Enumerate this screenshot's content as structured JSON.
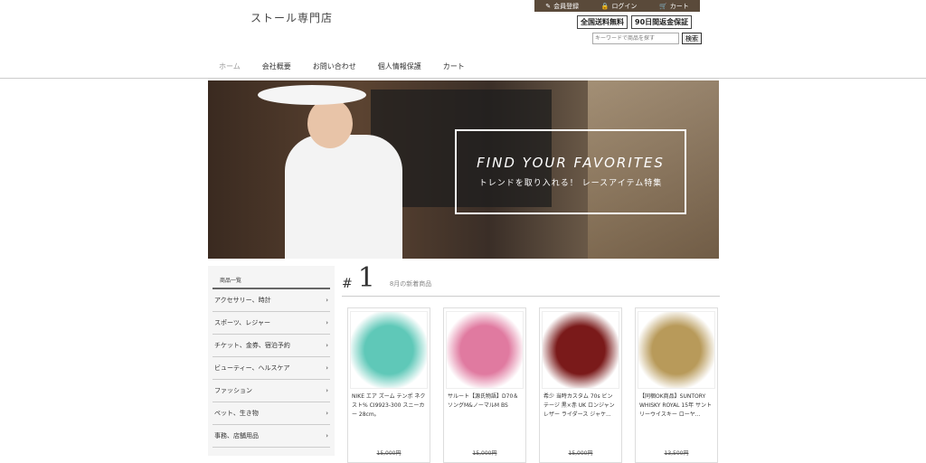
{
  "site": {
    "logo": "ストール専門店"
  },
  "topbar": {
    "register": "会員登録",
    "login": "ログイン",
    "cart": "カート"
  },
  "badges": [
    "全国送料無料",
    "90日間返金保証"
  ],
  "search": {
    "placeholder": "キーワードで商品を探す",
    "button": "検索"
  },
  "nav": [
    "ホーム",
    "会社概要",
    "お問い合わせ",
    "個人情報保護",
    "カート"
  ],
  "hero": {
    "title": "FIND YOUR FAVORITES",
    "subtitle": "トレンドを取り入れる！ レースアイテム特集"
  },
  "sidebar": {
    "title": "商品一覧",
    "items": [
      "アクセサリー、時計",
      "スポーツ、レジャー",
      "チケット、金券、宿泊予約",
      "ビューティー、ヘルスケア",
      "ファッション",
      "ペット、生き物",
      "事務、店舗用品"
    ]
  },
  "ranking": {
    "hash": "#",
    "number": "1",
    "subtitle": "8月の新着商品"
  },
  "products": [
    {
      "name": "NIKE エア ズーム テンポ ネクスト% CI9923-300 スニーカー 28cm。",
      "price": "15,000円",
      "color": "#5fc8b8"
    },
    {
      "name": "サルート【源氏物語】D70＆ソングM&ノーマルM BS",
      "price": "15,000円",
      "color": "#e07aa0"
    },
    {
      "name": "希少 当時カスタム 70s ビンテージ 黒×赤 UK ロンジャン レザー ライダース ジャケ...",
      "price": "15,000円",
      "color": "#7a1a1a"
    },
    {
      "name": "【同梱OK商品】SUNTORY WHISKY ROYAL 15年 サントリーウイスキー ローヤ...",
      "price": "13,500円",
      "color": "#b89a5a"
    }
  ]
}
